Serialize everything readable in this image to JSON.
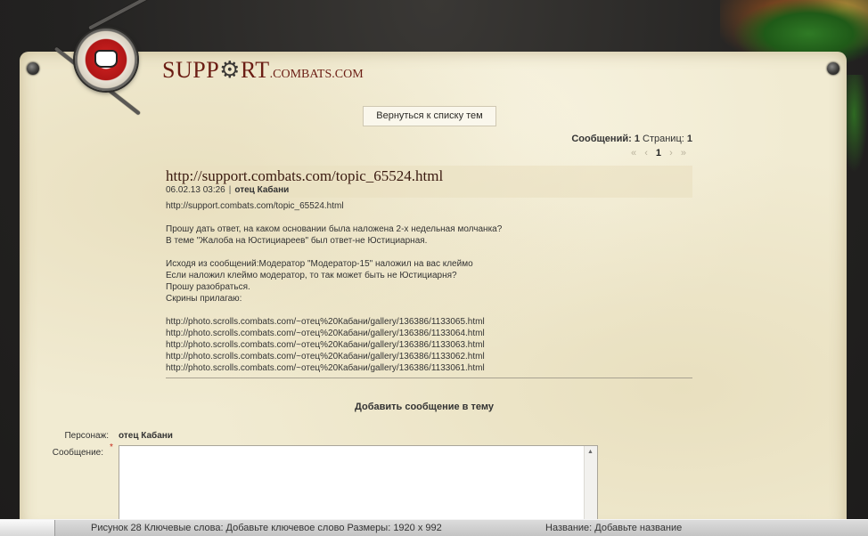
{
  "header": {
    "site_name": "SUPP",
    "gear_char": "⚙",
    "site_name_tail": "RT",
    "site_domain": ".COMBATS.COM"
  },
  "nav": {
    "back_label": "Вернуться к списку тем"
  },
  "stats": {
    "messages_label": "Сообщений:",
    "messages_count": "1",
    "pages_label": "Страниц:",
    "pages_count": "1"
  },
  "pager": {
    "first": "«",
    "prev": "‹",
    "current": "1",
    "next": "›",
    "last": "»"
  },
  "topic": {
    "title": "http://support.combats.com/topic_65524.html",
    "date": "06.02.13 03:26",
    "separator": "|",
    "author": "отец Кабани",
    "body_lines": [
      "http://support.combats.com/topic_65524.html",
      "",
      "Прошу дать ответ, на каком основании была наложена 2-х недельная молчанка?",
      "В теме \"Жалоба на Юстициареев\" был ответ-не Юстициарная.",
      "",
      "Исходя из сообщений:Модератор \"Модератор-15\" наложил на вас клеймо",
      "Если наложил клеймо модератор, то так может быть не Юстициарня?",
      "Прошу разобраться.",
      "Скрины прилагаю:",
      "",
      "http://photo.scrolls.combats.com/~отец%20Кабани/gallery/136386/1133065.html",
      "http://photo.scrolls.combats.com/~отец%20Кабани/gallery/136386/1133064.html",
      "http://photo.scrolls.combats.com/~отец%20Кабани/gallery/136386/1133063.html",
      "http://photo.scrolls.combats.com/~отец%20Кабани/gallery/136386/1133062.html",
      "http://photo.scrolls.combats.com/~отец%20Кабани/gallery/136386/1133061.html"
    ]
  },
  "reply_form": {
    "heading": "Добавить сообщение в тему",
    "character_label": "Персонаж:",
    "character_value": "отец Кабани",
    "message_label": "Сообщение:",
    "required_mark": "*",
    "message_value": ""
  },
  "bottom_strip": {
    "left_text": "Рисунок 28 Ключевые слова: Добавьте ключевое слово Размеры: 1920 x 992",
    "right_text": "Название: Добавьте название"
  },
  "colors": {
    "background": "#242322",
    "parchment": "#f1ebd2",
    "title_red": "#6b1d14",
    "required_red": "#c62a1c"
  }
}
